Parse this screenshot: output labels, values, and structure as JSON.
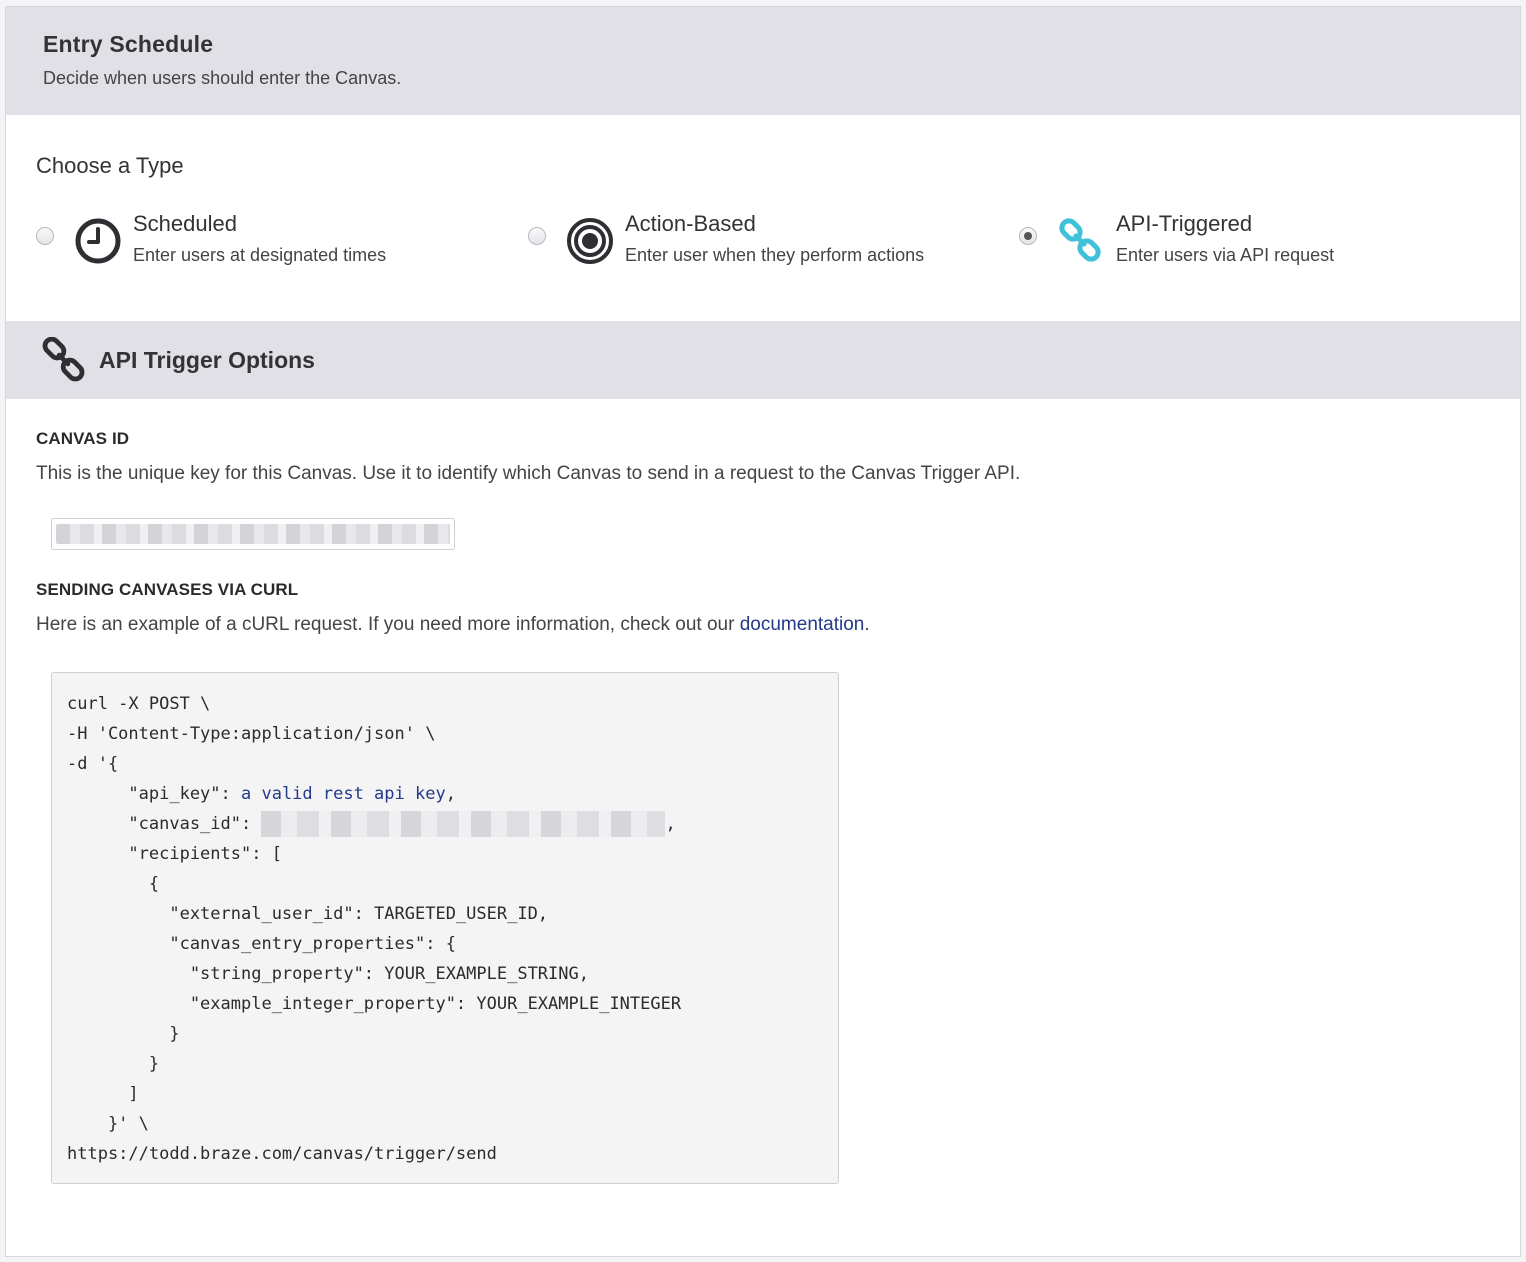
{
  "entry_schedule": {
    "title": "Entry Schedule",
    "subtitle": "Decide when users should enter the Canvas."
  },
  "choose_type": {
    "label": "Choose a Type",
    "options": [
      {
        "title": "Scheduled",
        "description": "Enter users at designated times",
        "icon": "clock-icon",
        "selected": false
      },
      {
        "title": "Action-Based",
        "description": "Enter user when they perform actions",
        "icon": "target-icon",
        "selected": false
      },
      {
        "title": "API-Triggered",
        "description": "Enter users via API request",
        "icon": "link-icon",
        "selected": true
      }
    ]
  },
  "api_trigger": {
    "title": "API Trigger Options",
    "icon": "link-icon"
  },
  "canvas_id": {
    "heading": "CANVAS ID",
    "description": "This is the unique key for this Canvas. Use it to identify which Canvas to send in a request to the Canvas Trigger API."
  },
  "curl": {
    "heading": "SENDING CANVASES VIA CURL",
    "description_before": "Here is an example of a cURL request. If you need more information, check out our ",
    "link_text": "documentation",
    "description_after": ".",
    "code": {
      "line1": "curl -X POST \\",
      "line2": "-H 'Content-Type:application/json' \\",
      "line3": "-d '{",
      "line4_key": "      \"api_key\": ",
      "line4_val": "a valid rest api key",
      "line4_end": ",",
      "line5_key": "      \"canvas_id\": ",
      "line5_end": ",",
      "line6": "      \"recipients\": [",
      "line7": "        {",
      "line8": "          \"external_user_id\": TARGETED_USER_ID,",
      "line9": "          \"canvas_entry_properties\": {",
      "line10": "            \"string_property\": YOUR_EXAMPLE_STRING,",
      "line11": "            \"example_integer_property\": YOUR_EXAMPLE_INTEGER",
      "line12": "          }",
      "line13": "        }",
      "line14": "      ]",
      "line15": "    }' \\",
      "line16": "https://todd.braze.com/canvas/trigger/send"
    }
  },
  "colors": {
    "header_bg": "#e0e0e6",
    "accent_teal": "#3fc2d9",
    "link_blue": "#23398a"
  }
}
